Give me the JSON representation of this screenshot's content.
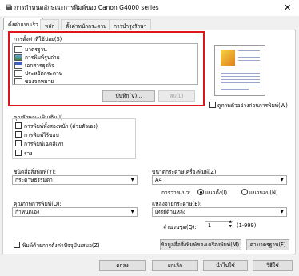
{
  "window": {
    "title": "การกำหนดลักษณะการพิมพ์ของ Canon G4000 series",
    "close_glyph": "✕"
  },
  "tabs": [
    {
      "label": "ตั้งค่าแบบเร็ว"
    },
    {
      "label": "หลัก"
    },
    {
      "label": "ตั้งค่าหน้ากระดาษ"
    },
    {
      "label": "การบำรุงรักษา"
    }
  ],
  "common_settings": {
    "label": "การตั้งค่าที่ใช้บ่อย(S)",
    "items": [
      {
        "label": "มาตรฐาน"
      },
      {
        "label": "การพิมพ์รูปถ่าย"
      },
      {
        "label": "เอกสารธุรกิจ"
      },
      {
        "label": "ประหยัดกระดาษ"
      },
      {
        "label": "ซองจดหมาย"
      }
    ],
    "save_button": "บันทึก(V)...",
    "delete_button": "ลบ(L)"
  },
  "always_print_current": "ดูภาพตัวอย่างก่อนการพิมพ์(W)",
  "additional_features": {
    "label": "คุณลักษณะเพิ่มเติม(I)",
    "items": [
      {
        "label": "การพิมพ์ทั้งสองหน้า (ด้วยตัวเอง)"
      },
      {
        "label": "การพิมพ์ไร้ขอบ"
      },
      {
        "label": "การพิมพ์เฉดสีเทา"
      },
      {
        "label": "ร่าง"
      }
    ]
  },
  "media_type": {
    "label": "ชนิดสื่อสิ่งพิมพ์(Y):",
    "value": "กระดาษธรรมดา"
  },
  "print_quality": {
    "label": "คุณภาพการพิมพ์(Q):",
    "value": "กำหนดเอง"
  },
  "page_size": {
    "label": "ขนาดกระดาษเครื่องพิมพ์(Z):",
    "value": "A4"
  },
  "orientation": {
    "label": "การวางแนว:",
    "portrait": "แนวตั้ง(I)",
    "landscape": "แนวนอน(N)"
  },
  "paper_source": {
    "label": "แหล่งจ่ายกระดาษ(E):",
    "value": "เทรย์ด้านหลัง"
  },
  "copies": {
    "label": "จำนวนชุด(Q):",
    "value": "1",
    "range": "(1-999)"
  },
  "always_print": "พิมพ์ด้วยการตั้งค่าปัจจุบันเสมอ(Z)",
  "buttons": {
    "paper_info": "ข้อมูลสื่อสิ่งพิมพ์ของเครื่องพิมพ์(M)...",
    "defaults": "ค่ามาตรฐาน(F)",
    "ok": "ตกลง",
    "cancel": "ยกเลิก",
    "apply": "นำไปใช้",
    "help": "วิธีใช้"
  }
}
